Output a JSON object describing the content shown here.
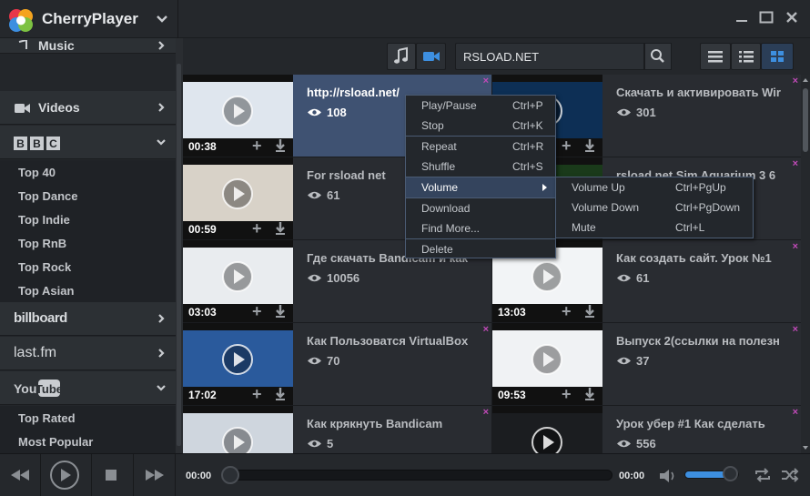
{
  "app": {
    "title": "CherryPlayer"
  },
  "search": {
    "value": "RSLOAD.NET"
  },
  "sidebar": {
    "top_partial_label": "Music",
    "videos_label": "Videos",
    "bbc_label": "BBC",
    "bbc_items": [
      "Top 40",
      "Top Dance",
      "Top Indie",
      "Top RnB",
      "Top Rock",
      "Top Asian"
    ],
    "billboard_label": "billboard",
    "lastfm_label": "last.fm",
    "youtube_label": "YouTube",
    "youtube_items": [
      "Top Rated",
      "Most Popular"
    ]
  },
  "tiles": [
    {
      "title": "http://rsload.net/",
      "views": "108",
      "duration": "00:38",
      "selected": true
    },
    {
      "title": "Скачать и активировать Wir",
      "views": "301",
      "duration": ""
    },
    {
      "title": "For rsload net",
      "views": "61",
      "duration": "00:59"
    },
    {
      "title": "rsload net Sim Aquarium 3 6",
      "views": "",
      "duration": ""
    },
    {
      "title": "Где скачать Bandicam и как",
      "views": "10056",
      "duration": "03:03"
    },
    {
      "title": "Как создать сайт. Урок №1",
      "views": "61",
      "duration": "13:03"
    },
    {
      "title": "Как Пользоватся VirtualBox",
      "views": "70",
      "duration": "17:02"
    },
    {
      "title": "Выпуск 2(ссылки на полезн",
      "views": "37",
      "duration": "09:53"
    },
    {
      "title": "Как крякнуть Bandicam",
      "views": "5",
      "duration": ""
    },
    {
      "title": "Урок убер #1 Как сделать",
      "views": "556",
      "duration": ""
    }
  ],
  "context_menu": {
    "items": [
      {
        "label": "Play/Pause",
        "shortcut": "Ctrl+P"
      },
      {
        "label": "Stop",
        "shortcut": "Ctrl+K"
      },
      {
        "label": "Repeat",
        "shortcut": "Ctrl+R"
      },
      {
        "label": "Shuffle",
        "shortcut": "Ctrl+S"
      },
      {
        "label": "Volume",
        "shortcut": ""
      },
      {
        "label": "Download",
        "shortcut": ""
      },
      {
        "label": "Find More...",
        "shortcut": ""
      },
      {
        "label": "Delete",
        "shortcut": ""
      }
    ],
    "volume_submenu": [
      {
        "label": "Volume Up",
        "shortcut": "Ctrl+PgUp"
      },
      {
        "label": "Volume Down",
        "shortcut": "Ctrl+PgDown"
      },
      {
        "label": "Mute",
        "shortcut": "Ctrl+L"
      }
    ]
  },
  "player": {
    "current_time": "00:00",
    "total_time": "00:00",
    "volume_level": 0.85
  },
  "colors": {
    "accent": "#3d8fe0",
    "selected": "#3f5272",
    "close_x": "#c04ab8"
  }
}
